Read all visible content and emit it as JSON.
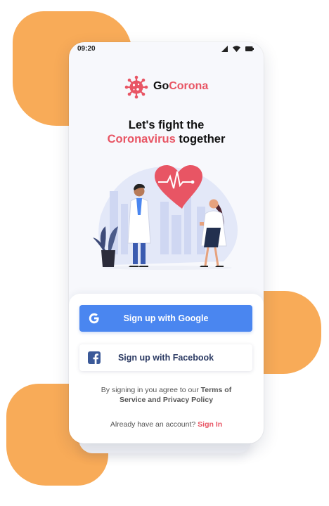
{
  "status": {
    "time": "09:20"
  },
  "brand": {
    "name_prefix": "Go",
    "name_accent": "Corona"
  },
  "headline": {
    "line1": "Let's fight the",
    "accent": "Coronavirus",
    "rest": " together"
  },
  "buttons": {
    "google": "Sign up with Google",
    "facebook": "Sign up with Facebook"
  },
  "terms": {
    "prefix": "By signing in you agree to our ",
    "link1": "Terms of",
    "link2": "Service and Privacy Policy"
  },
  "signin": {
    "prompt": "Already have an account? ",
    "link": "Sign In"
  },
  "colors": {
    "accent": "#e85564",
    "google_blue": "#4a86f0",
    "facebook_blue": "#3b5998",
    "blob_orange": "#f8ab58"
  },
  "icons": [
    "signal-icon",
    "wifi-icon",
    "battery-icon",
    "virus-logo-icon",
    "google-icon",
    "facebook-icon"
  ]
}
